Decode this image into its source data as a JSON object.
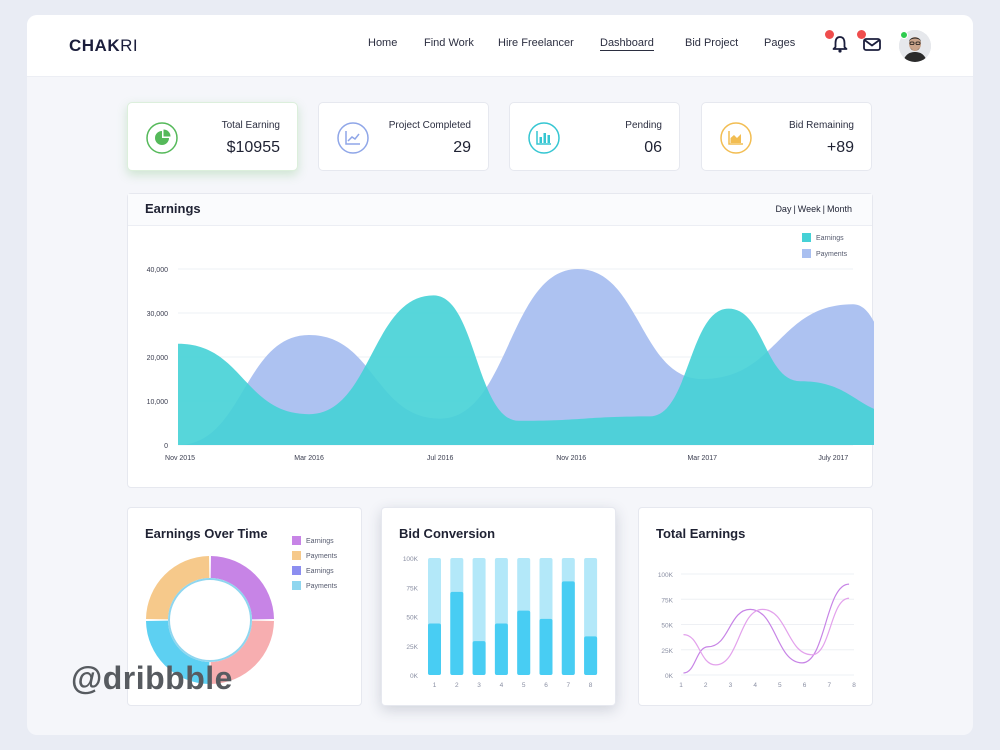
{
  "brand": {
    "bold": "CHAK",
    "thin": "RI"
  },
  "nav": [
    "Home",
    "Find Work",
    "Hire Freelancer",
    "Dashboard",
    "Bid Project",
    "Pages"
  ],
  "nav_active": "Dashboard",
  "icons": {
    "bell": "bell-icon",
    "mail": "mail-icon",
    "avatar": "user-avatar"
  },
  "stats": [
    {
      "label": "Total Earning",
      "value": "$10955",
      "icon": "pie-chart-icon",
      "color": "#55b95a"
    },
    {
      "label": "Project Completed",
      "value": "29",
      "icon": "trend-icon",
      "color": "#8fa6e8"
    },
    {
      "label": "Pending",
      "value": "06",
      "icon": "bar-chart-icon",
      "color": "#35c6d2"
    },
    {
      "label": "Bid Remaining",
      "value": "+89",
      "icon": "area-chart-icon",
      "color": "#f2bd52"
    }
  ],
  "earnings": {
    "title": "Earnings",
    "range": [
      "Day",
      "Week",
      "Month"
    ]
  },
  "earnings_over_time": {
    "title": "Earnings Over Time"
  },
  "bid_conversion": {
    "title": "Bid Conversion"
  },
  "total_earnings": {
    "title": "Total Earnings"
  },
  "watermark": "@dribbble",
  "colors": {
    "teal": "#45d1d6",
    "lavender": "#a9bff0",
    "purple": "#c784e6",
    "peach": "#f6c98b",
    "pink": "#f7aeb0",
    "sky": "#5dd0f2",
    "bar_light": "#b3e8f9",
    "bar_dark": "#48cdf3"
  },
  "chart_data": [
    {
      "type": "area",
      "title": "Earnings",
      "x": [
        "Nov 2015",
        "Mar 2016",
        "Jul 2016",
        "Nov 2016",
        "Mar 2017",
        "July 2017"
      ],
      "y_ticks": [
        "0",
        "10,000",
        "20,000",
        "30,000",
        "40,000"
      ],
      "ylim": [
        0,
        40000
      ],
      "series": [
        {
          "name": "Earnings",
          "color": "#45d1d6",
          "points": [
            [
              0,
              23000
            ],
            [
              1,
              7000
            ],
            [
              1.95,
              34000
            ],
            [
              2.6,
              5500
            ],
            [
              3.6,
              6500
            ],
            [
              4.2,
              31000
            ],
            [
              4.75,
              14500
            ],
            [
              5.6,
              6500
            ],
            [
              6.15,
              38000
            ]
          ]
        },
        {
          "name": "Payments",
          "color": "#a9bff0",
          "points": [
            [
              0,
              0.5
            ],
            [
              1,
              25000
            ],
            [
              2.0,
              6000
            ],
            [
              3.05,
              40000
            ],
            [
              4.0,
              15000
            ],
            [
              5.15,
              32000
            ],
            [
              5.65,
              10500
            ],
            [
              6.15,
              10000
            ]
          ]
        }
      ],
      "legend": "top-right"
    },
    {
      "type": "pie",
      "title": "Earnings Over Time",
      "labels": [
        "Earnings",
        "Payments",
        "Earnings",
        "Payments"
      ],
      "label_colors": [
        "#c784e6",
        "#f6c98b",
        "#8c8ef0",
        "#8fd6ef"
      ],
      "values": [
        25,
        25,
        25,
        25
      ],
      "colors": [
        "#c784e6",
        "#f7aeb0",
        "#5dd0f2",
        "#f6c98b"
      ]
    },
    {
      "type": "bar",
      "title": "Bid Conversion",
      "categories": [
        "1",
        "2",
        "3",
        "4",
        "5",
        "6",
        "7",
        "8"
      ],
      "y_ticks": [
        "0K",
        "25K",
        "50K",
        "75K",
        "100K"
      ],
      "ylim": [
        0,
        100
      ],
      "max": [
        100,
        100,
        100,
        100,
        100,
        100,
        100,
        100
      ],
      "values": [
        44,
        71,
        29,
        44,
        55,
        48,
        80,
        33
      ]
    },
    {
      "type": "line",
      "title": "Total Earnings",
      "categories": [
        "1",
        "2",
        "3",
        "4",
        "5",
        "6",
        "7",
        "8"
      ],
      "y_ticks": [
        "0K",
        "25K",
        "50K",
        "75K",
        "100K"
      ],
      "ylim": [
        0,
        100
      ],
      "series": [
        {
          "name": "",
          "color": "#c784e6",
          "points": [
            [
              0.1,
              2
            ],
            [
              1.1,
              28
            ],
            [
              2.8,
              65
            ],
            [
              4.9,
              12
            ],
            [
              6.8,
              90
            ]
          ]
        },
        {
          "name": "",
          "color": "#e3a2ec",
          "points": [
            [
              0.1,
              40
            ],
            [
              1.4,
              10
            ],
            [
              3.3,
              65
            ],
            [
              5.3,
              20
            ],
            [
              6.8,
              76
            ]
          ]
        }
      ]
    }
  ]
}
